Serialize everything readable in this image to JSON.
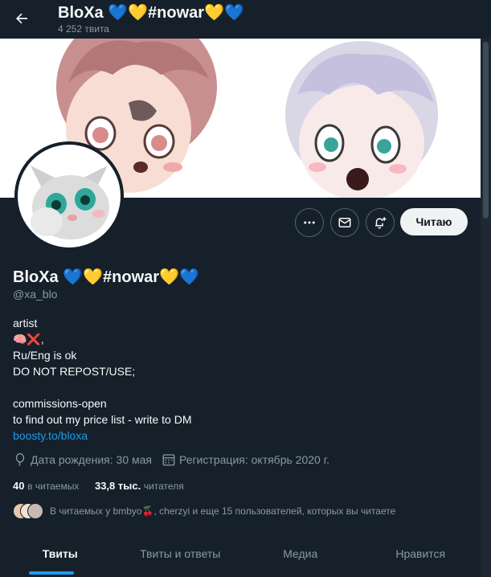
{
  "header": {
    "title": "BloXa 💙💛#nowar💛💙",
    "tweet_count": "4 252 твита",
    "back_icon": "arrow-left-icon"
  },
  "actions": {
    "more_icon": "more-icon",
    "message_icon": "envelope-icon",
    "notify_icon": "bell-plus-icon",
    "follow_label": "Читаю"
  },
  "profile": {
    "name": "BloXa 💙💛#nowar💛💙",
    "handle": "@xa_blo",
    "bio": {
      "line1": "artist",
      "line2": "🧠❌,",
      "line3": "Ru/Eng is ok",
      "line4": "DO NOT REPOST/USE;",
      "line5": "commissions-open",
      "line6": "to find out my price list - write to DM",
      "link": "boosty.to/bloxa"
    },
    "birthday": "Дата рождения: 30 мая",
    "joined": "Регистрация: октябрь 2020 г.",
    "following_count": "40",
    "following_label": "в читаемых",
    "followers_count": "33,8 тыс.",
    "followers_label": "читателя",
    "followed_by": "В читаемых у bmbyo🍒, cherzyi и еще 15 пользователей, которых вы читаете"
  },
  "tabs": [
    "Твиты",
    "Твиты и ответы",
    "Медиа",
    "Нравится"
  ],
  "colors": {
    "background": "#15202b",
    "accent": "#1d9bf0",
    "secondary_text": "#8b98a5"
  }
}
